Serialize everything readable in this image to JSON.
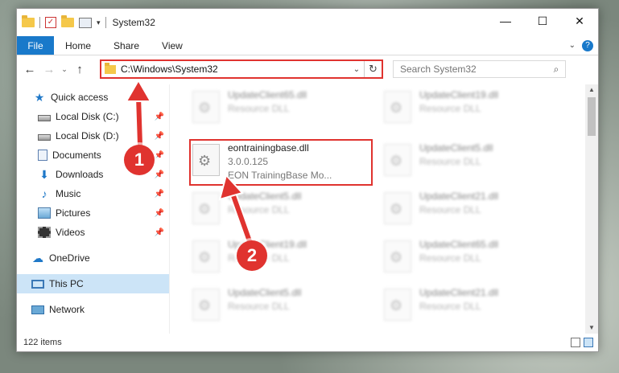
{
  "window": {
    "title": "System32",
    "controls": [
      "—",
      "☐",
      "✕"
    ]
  },
  "ribbon": {
    "file": "File",
    "tabs": [
      "Home",
      "Share",
      "View"
    ]
  },
  "navigation": {
    "address": "C:\\Windows\\System32",
    "search_placeholder": "Search System32"
  },
  "sidebar": {
    "items": [
      {
        "label": "Quick access",
        "icon": "star-icon",
        "pinned": false
      },
      {
        "label": "Local Disk (C:)",
        "icon": "disk-icon",
        "pinned": true
      },
      {
        "label": "Local Disk (D:)",
        "icon": "disk-icon",
        "pinned": true
      },
      {
        "label": "Documents",
        "icon": "documents-icon",
        "pinned": true
      },
      {
        "label": "Downloads",
        "icon": "download-icon",
        "pinned": true
      },
      {
        "label": "Music",
        "icon": "music-icon",
        "pinned": true
      },
      {
        "label": "Pictures",
        "icon": "pictures-icon",
        "pinned": true
      },
      {
        "label": "Videos",
        "icon": "videos-icon",
        "pinned": true
      },
      {
        "label": "OneDrive",
        "icon": "cloud-icon",
        "pinned": false
      },
      {
        "label": "This PC",
        "icon": "pc-icon",
        "pinned": false,
        "selected": true
      },
      {
        "label": "Network",
        "icon": "network-icon",
        "pinned": false
      }
    ]
  },
  "files": [
    {
      "name": "UpdateClient65.dll",
      "sub": "Resource DLL",
      "blurred": true
    },
    {
      "name": "UpdateClient19.dll",
      "sub": "Resource DLL",
      "blurred": true
    },
    {
      "name": "eontrainingbase.dll",
      "sub": "3.0.0.125",
      "sub2": "EON TrainingBase Mo...",
      "blurred": false
    },
    {
      "name": "UpdateClient5.dll",
      "sub": "Resource DLL",
      "blurred": true
    },
    {
      "name": "UpdateClient5.dll",
      "sub": "Resource DLL",
      "blurred": true
    },
    {
      "name": "UpdateClient21.dll",
      "sub": "Resource DLL",
      "blurred": true
    },
    {
      "name": "UpdateClient19.dll",
      "sub": "Resource DLL",
      "blurred": true
    },
    {
      "name": "UpdateClient65.dll",
      "sub": "Resource DLL",
      "blurred": true
    },
    {
      "name": "UpdateClient5.dll",
      "sub": "Resource DLL",
      "blurred": true
    },
    {
      "name": "UpdateClient21.dll",
      "sub": "Resource DLL",
      "blurred": true
    }
  ],
  "status": {
    "count": "122 items"
  },
  "annotations": {
    "step1": "1",
    "step2": "2",
    "color": "#e0332f"
  }
}
